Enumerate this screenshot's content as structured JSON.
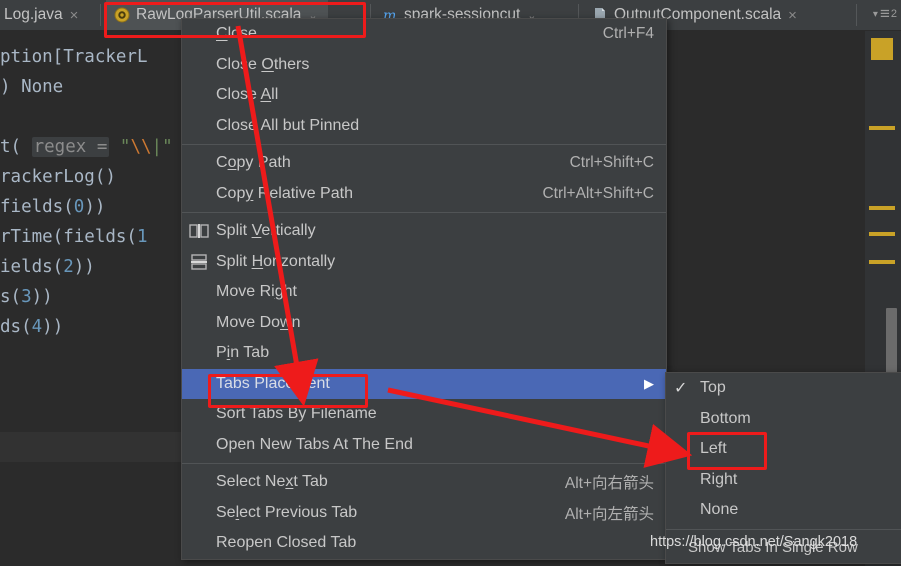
{
  "colors": {
    "editor_bg": "#2b2b2b",
    "menu_bg": "#3c3f41",
    "menu_highlight": "#4a68b5",
    "tab_active_bg": "#4e5254",
    "annotation_red": "#ee1b1b",
    "marker_yellow": "#c9a227",
    "text": "#c8c8c8"
  },
  "tabs": [
    {
      "label": "Log.java",
      "icon": "java-file-icon",
      "close": "×",
      "active": false
    },
    {
      "label": "RawLogParserUtil.scala",
      "icon": "scala-object-icon",
      "chevron": "⌄",
      "active": true
    },
    {
      "label": "spark-sessioncut",
      "icon": "maven-module-icon",
      "chevron": "⌄",
      "active": false
    },
    {
      "label": "OutputComponent.scala",
      "icon": "scala-file-icon",
      "close": "×",
      "active": false
    }
  ],
  "tab_list_button": {
    "name": "show-tab-list",
    "arrow": "▾",
    "glyph": "≡",
    "badge": "2"
  },
  "editor": {
    "lines": [
      "ption[TrackerL",
      ") None",
      "",
      "t( regex = \"\\\\|\"",
      "rackerLog()",
      "fields(0))",
      "rTime(fields(1",
      "ields(2))",
      "s(3))",
      "ds(4))"
    ],
    "hint_text": "regex =",
    "string_text": "\"\\\\|\""
  },
  "context_menu": {
    "items": [
      {
        "label": "Close",
        "accel": "Ctrl+F4",
        "icon": "",
        "mnemonic": "C",
        "selected": false
      },
      {
        "label": "Close Others",
        "accel": "",
        "icon": "",
        "mnemonic": "O",
        "selected": false
      },
      {
        "label": "Close All",
        "accel": "",
        "icon": "",
        "mnemonic": "A",
        "selected": false
      },
      {
        "label": "Close All but Pinned",
        "accel": "",
        "icon": "",
        "selected": false
      },
      {
        "separator": true
      },
      {
        "label": "Copy Path",
        "accel": "Ctrl+Shift+C",
        "icon": "",
        "mnemonic": "o",
        "selected": false
      },
      {
        "label": "Copy Relative Path",
        "accel": "Ctrl+Alt+Shift+C",
        "icon": "",
        "mnemonic": "y",
        "selected": false
      },
      {
        "separator": true
      },
      {
        "label": "Split Vertically",
        "accel": "",
        "icon": "split-vertically-icon",
        "mnemonic": "V",
        "selected": false
      },
      {
        "label": "Split Horizontally",
        "accel": "",
        "icon": "split-horizontally-icon",
        "mnemonic": "H",
        "selected": false
      },
      {
        "label": "Move Right",
        "accel": "",
        "icon": "",
        "mnemonic": "g",
        "selected": false
      },
      {
        "label": "Move Down",
        "accel": "",
        "icon": "",
        "mnemonic": "w",
        "selected": false
      },
      {
        "label": "Pin Tab",
        "accel": "",
        "icon": "",
        "mnemonic": "i",
        "selected": false
      },
      {
        "label": "Tabs Placement",
        "accel": "",
        "icon": "",
        "submenu_arrow": "▶",
        "selected": true
      },
      {
        "label": "Sort Tabs By Filename",
        "accel": "",
        "icon": "",
        "selected": false
      },
      {
        "label": "Open New Tabs At The End",
        "accel": "",
        "icon": "",
        "selected": false
      },
      {
        "separator": true
      },
      {
        "label": "Select Next Tab",
        "accel": "Alt+向右箭头",
        "icon": "",
        "mnemonic": "x",
        "selected": false
      },
      {
        "label": "Select Previous Tab",
        "accel": "Alt+向左箭头",
        "icon": "",
        "mnemonic": "l",
        "selected": false
      },
      {
        "label": "Reopen Closed Tab",
        "accel": "",
        "icon": "",
        "selected": false
      }
    ]
  },
  "submenu": {
    "items": [
      {
        "label": "Top",
        "checked": true
      },
      {
        "label": "Bottom",
        "checked": false
      },
      {
        "label": "Left",
        "checked": false
      },
      {
        "label": "Right",
        "checked": false
      },
      {
        "label": "None",
        "checked": false
      },
      {
        "separator": true
      },
      {
        "label": "Show Tabs In Single Row",
        "checked": false
      }
    ]
  },
  "watermark": {
    "text": "https://blog.csdn.net/Sangk2018"
  },
  "annotations": {
    "boxes": [
      {
        "name": "active-tab-highlight-box"
      },
      {
        "name": "tabs-placement-highlight-box"
      },
      {
        "name": "left-option-highlight-box"
      }
    ],
    "arrows": [
      {
        "name": "arrow-tab-to-tabs-placement"
      },
      {
        "name": "arrow-tabs-placement-to-left"
      }
    ]
  }
}
